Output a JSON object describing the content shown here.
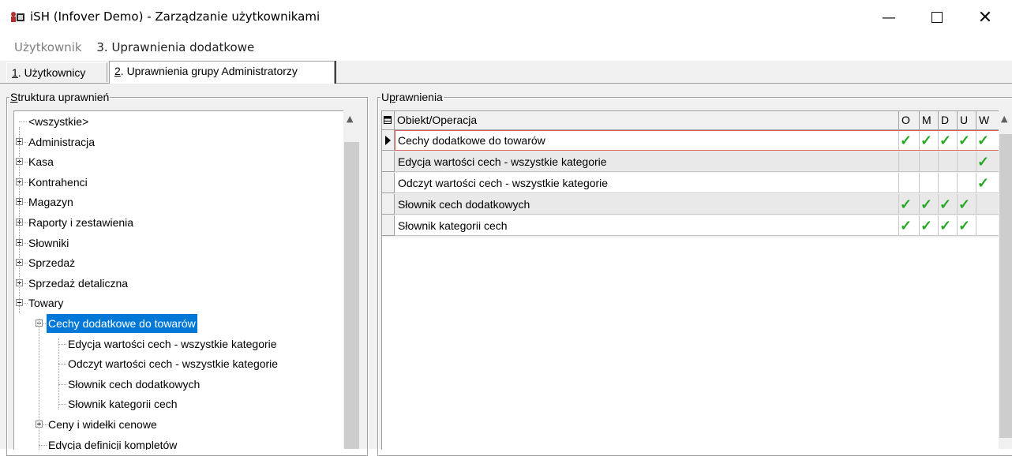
{
  "window": {
    "title": "iSH (Infover Demo) - Zarządzanie użytkownikami",
    "minimize_glyph": "—",
    "close_glyph": "✕"
  },
  "breadcrumb": {
    "items": [
      "Użytkownik",
      "3. Uprawnienia dodatkowe"
    ]
  },
  "tabs": [
    {
      "hotkey": "1",
      "label": ". Użytkownicy",
      "active": false
    },
    {
      "hotkey": "2",
      "label": ". Uprawnienia grupy Administratorzy",
      "active": true
    }
  ],
  "left_panel": {
    "legend_hotkey": "S",
    "legend_rest": "truktura uprawnień",
    "tree": [
      {
        "label": "<wszystkie>",
        "level": 0,
        "expander": "none"
      },
      {
        "label": "Administracja",
        "level": 0,
        "expander": "plus"
      },
      {
        "label": "Kasa",
        "level": 0,
        "expander": "plus"
      },
      {
        "label": "Kontrahenci",
        "level": 0,
        "expander": "plus"
      },
      {
        "label": "Magazyn",
        "level": 0,
        "expander": "plus"
      },
      {
        "label": "Raporty i zestawienia",
        "level": 0,
        "expander": "plus"
      },
      {
        "label": "Słowniki",
        "level": 0,
        "expander": "plus"
      },
      {
        "label": "Sprzedaż",
        "level": 0,
        "expander": "plus"
      },
      {
        "label": "Sprzedaż detaliczna",
        "level": 0,
        "expander": "plus"
      },
      {
        "label": "Towary",
        "level": 0,
        "expander": "minus"
      },
      {
        "label": "Cechy dodatkowe do towarów",
        "level": 1,
        "expander": "minus",
        "selected": true
      },
      {
        "label": "Edycja wartości cech - wszystkie kategorie",
        "level": 2,
        "expander": "none"
      },
      {
        "label": "Odczyt wartości cech - wszystkie kategorie",
        "level": 2,
        "expander": "none"
      },
      {
        "label": "Słownik cech dodatkowych",
        "level": 2,
        "expander": "none"
      },
      {
        "label": "Słownik kategorii cech",
        "level": 2,
        "expander": "none"
      },
      {
        "label": "Ceny i widełki cenowe",
        "level": 1,
        "expander": "plus"
      },
      {
        "label": "Edycja definicji kompletów",
        "level": 1,
        "expander": "none"
      }
    ]
  },
  "right_panel": {
    "legend_pre": "U",
    "legend_hotkey": "p",
    "legend_rest": "rawnienia",
    "columns": [
      "Obiekt/Operacja",
      "O",
      "M",
      "D",
      "U",
      "W"
    ],
    "check_glyph": "✓",
    "rows": [
      {
        "name": "Cechy dodatkowe do towarów",
        "flags": [
          true,
          true,
          true,
          true,
          true
        ],
        "current": true
      },
      {
        "name": "Edycja wartości cech - wszystkie kategorie",
        "flags": [
          false,
          false,
          false,
          false,
          true
        ],
        "current": false
      },
      {
        "name": "Odczyt wartości cech - wszystkie kategorie",
        "flags": [
          false,
          false,
          false,
          false,
          true
        ],
        "current": false
      },
      {
        "name": "Słownik cech dodatkowych",
        "flags": [
          true,
          true,
          true,
          true,
          false
        ],
        "current": false
      },
      {
        "name": "Słownik kategorii cech",
        "flags": [
          true,
          true,
          true,
          true,
          false
        ],
        "current": false
      }
    ]
  },
  "colors": {
    "selection": "#0078d7",
    "check": "#22a822",
    "current_row_outline": "#e06060"
  }
}
